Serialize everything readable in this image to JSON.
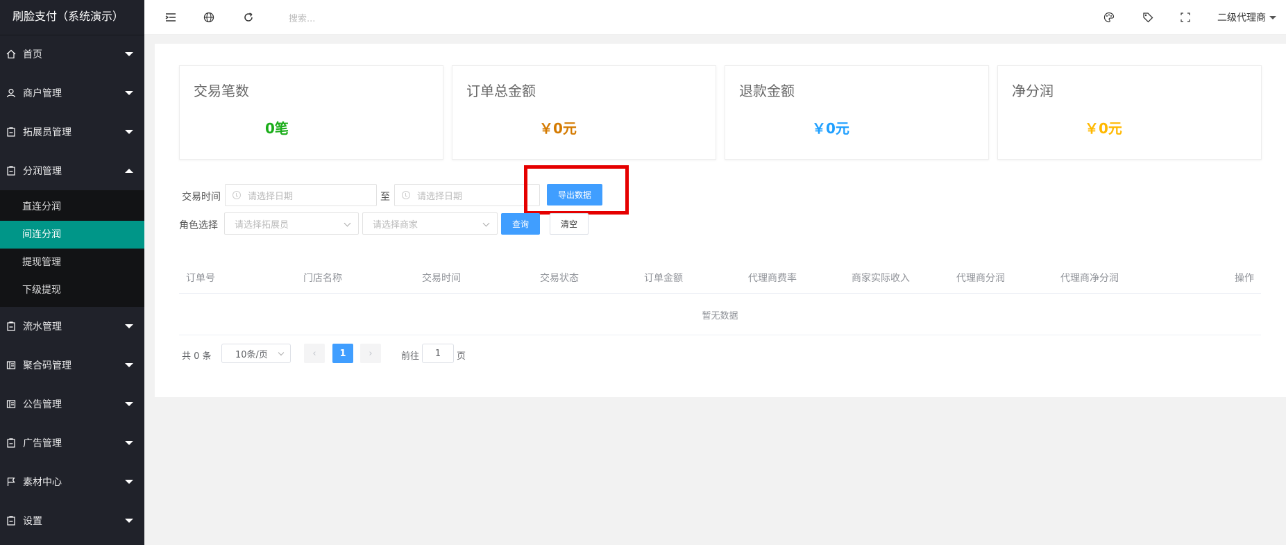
{
  "app": {
    "title": "刷脸支付（系统演示）"
  },
  "header": {
    "search_placeholder": "搜索...",
    "user_name": "二级代理商"
  },
  "sidebar": {
    "items": [
      {
        "label": "首页",
        "icon": "home-icon"
      },
      {
        "label": "商户管理",
        "icon": "user-icon"
      },
      {
        "label": "拓展员管理",
        "icon": "clipboard-icon"
      },
      {
        "label": "分润管理",
        "icon": "clipboard-icon",
        "expanded": true,
        "children": [
          {
            "label": "直连分润"
          },
          {
            "label": "间连分润",
            "active": true
          },
          {
            "label": "提现管理"
          },
          {
            "label": "下级提现"
          }
        ]
      },
      {
        "label": "流水管理",
        "icon": "clipboard-icon"
      },
      {
        "label": "聚合码管理",
        "icon": "grid-icon"
      },
      {
        "label": "公告管理",
        "icon": "grid-icon"
      },
      {
        "label": "广告管理",
        "icon": "clipboard-icon"
      },
      {
        "label": "素材中心",
        "icon": "flag-icon"
      },
      {
        "label": "设置",
        "icon": "clipboard-icon"
      }
    ]
  },
  "stats": [
    {
      "title": "交易笔数",
      "value": "0笔",
      "color": "#1aad19"
    },
    {
      "title": "订单总金额",
      "value": "￥0元",
      "color": "#d47a00"
    },
    {
      "title": "退款金额",
      "value": "￥0元",
      "color": "#1e9fff"
    },
    {
      "title": "净分润",
      "value": "￥0元",
      "color": "#ffb800"
    }
  ],
  "filters": {
    "time_label": "交易时间",
    "date_placeholder": "请选择日期",
    "to_label": "至",
    "export_button": "导出数据",
    "role_label": "角色选择",
    "expander_placeholder": "请选择拓展员",
    "merchant_placeholder": "请选择商家",
    "query_button": "查询",
    "clear_button": "清空"
  },
  "table": {
    "columns": [
      "订单号",
      "门店名称",
      "交易时间",
      "交易状态",
      "订单金额",
      "代理商费率",
      "商家实际收入",
      "代理商分润",
      "代理商净分润",
      "操作"
    ],
    "empty_text": "暂无数据"
  },
  "pagination": {
    "total_text": "共 0 条",
    "page_size": "10条/页",
    "current_page": "1",
    "goto_label": "前往",
    "goto_value": "1",
    "page_suffix": "页"
  }
}
